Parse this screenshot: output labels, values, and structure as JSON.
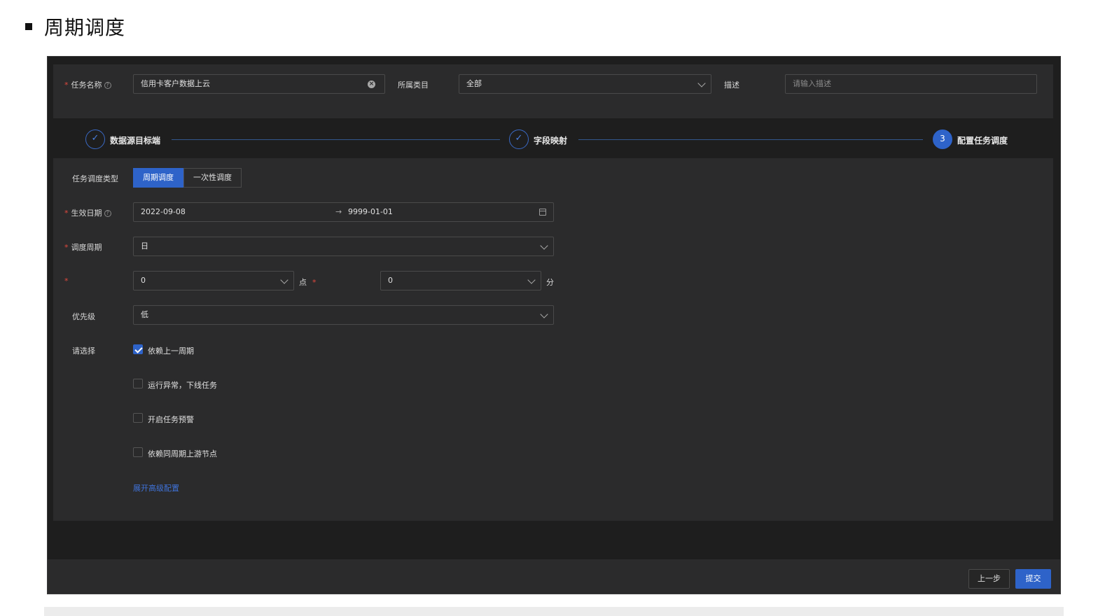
{
  "doc": {
    "title": "周期调度"
  },
  "top_form": {
    "task_name_label": "任务名称",
    "task_name_value": "信用卡客户数据上云",
    "category_label": "所属类目",
    "category_value": "全部",
    "desc_label": "描述",
    "desc_placeholder": "请输入描述",
    "help_glyph": "?",
    "clear_glyph": "×"
  },
  "steps": [
    {
      "label": "数据源目标端",
      "state": "done",
      "glyph": "✓"
    },
    {
      "label": "字段映射",
      "state": "done",
      "glyph": "✓"
    },
    {
      "label": "配置任务调度",
      "state": "active",
      "glyph": "3"
    }
  ],
  "schedule": {
    "type_label": "任务调度类型",
    "type_options": [
      "周期调度",
      "一次性调度"
    ],
    "type_selected": "周期调度",
    "date_label": "生效日期",
    "date_start": "2022-09-08",
    "date_arrow": "→",
    "date_end": "9999-01-01",
    "cycle_label": "调度周期",
    "cycle_value": "日",
    "hour_value": "0",
    "hour_unit": "点",
    "minute_value": "0",
    "minute_unit": "分",
    "priority_label": "优先级",
    "priority_value": "低",
    "select_label": "请选择",
    "options": [
      {
        "label": "依赖上一周期",
        "checked": true
      },
      {
        "label": "运行异常，下线任务",
        "checked": false
      },
      {
        "label": "开启任务预警",
        "checked": false
      },
      {
        "label": "依赖同周期上游节点",
        "checked": false
      }
    ],
    "advanced_link": "展开高级配置"
  },
  "footer": {
    "prev_label": "上一步",
    "submit_label": "提交"
  },
  "colors": {
    "accent": "#2e63c9",
    "panel": "#2b2b2c",
    "frame": "#1e1e1e",
    "required": "#e0493e"
  }
}
